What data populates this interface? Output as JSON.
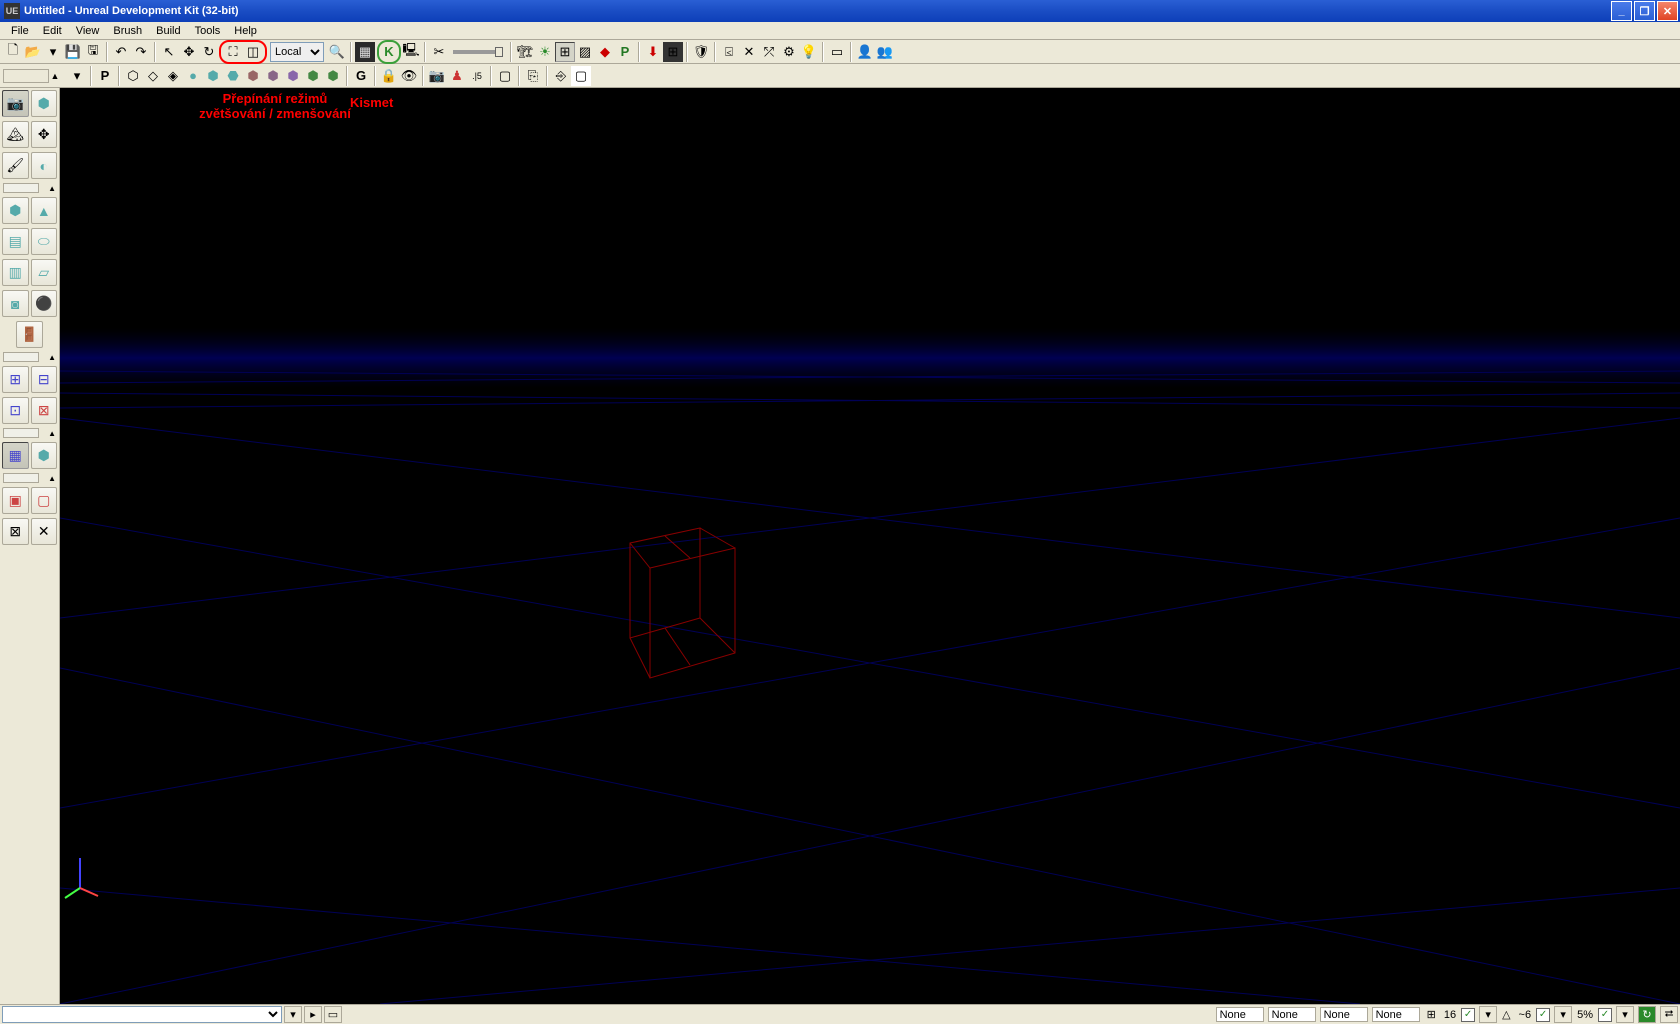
{
  "titlebar": {
    "text": "Untitled - Unreal Development Kit (32-bit)",
    "icon_label": "UE"
  },
  "menu": {
    "file": "File",
    "edit": "Edit",
    "view": "View",
    "brush": "Brush",
    "build": "Build",
    "tools": "Tools",
    "help": "Help"
  },
  "toolbar1": {
    "coord_space": "Local",
    "kismet_icon": "K"
  },
  "toolbar2": {
    "p_label": "P",
    "g_label": "G",
    "s_label": ".|5"
  },
  "annotations": {
    "zoom": "Přepínání režimů\nzvětšování / zmenšování",
    "kismet": "Kismet"
  },
  "statusbar": {
    "field1": "None",
    "field2": "None",
    "field3": "None",
    "field4": "None",
    "grid_value": "16",
    "angle_value": "~6",
    "pct_value": "5%",
    "triangle": "△",
    "grid_icon": "⊞"
  }
}
